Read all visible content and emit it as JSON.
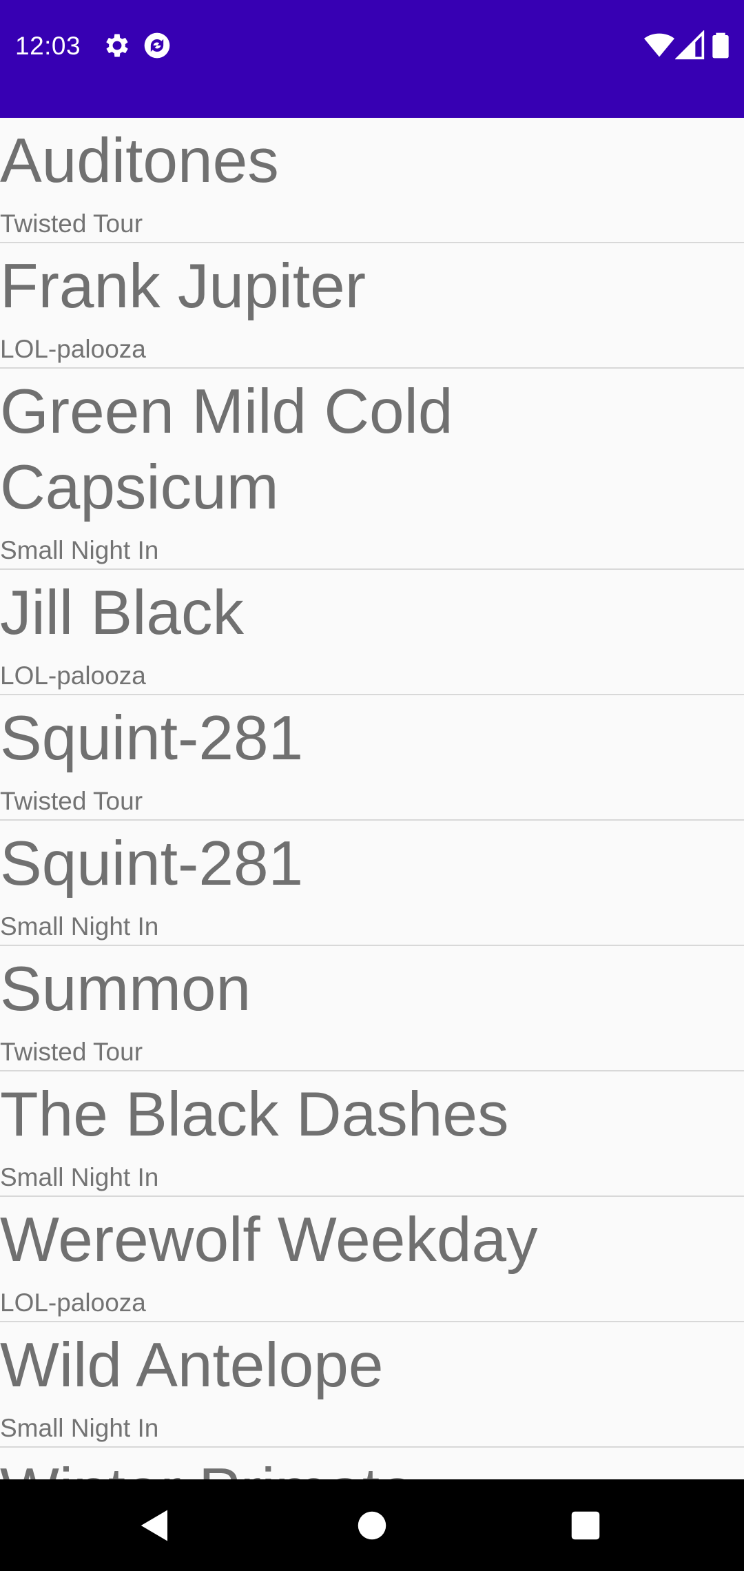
{
  "status_bar": {
    "time": "12:03",
    "left_icons": [
      "gear-icon",
      "sync-icon"
    ],
    "right_icons": [
      "wifi-icon",
      "signal-icon",
      "battery-icon"
    ],
    "background_color": "#3700b3"
  },
  "list": {
    "items": [
      {
        "title": "Auditones",
        "subtitle": "Twisted Tour"
      },
      {
        "title": "Frank Jupiter",
        "subtitle": "LOL-palooza"
      },
      {
        "title": "Green Mild Cold Capsicum",
        "subtitle": "Small Night In"
      },
      {
        "title": "Jill Black",
        "subtitle": "LOL-palooza"
      },
      {
        "title": "Squint-281",
        "subtitle": "Twisted Tour"
      },
      {
        "title": "Squint-281",
        "subtitle": "Small Night In"
      },
      {
        "title": "Summon",
        "subtitle": "Twisted Tour"
      },
      {
        "title": "The Black Dashes",
        "subtitle": "Small Night In"
      },
      {
        "title": "Werewolf Weekday",
        "subtitle": "LOL-palooza"
      },
      {
        "title": "Wild Antelope",
        "subtitle": "Small Night In"
      },
      {
        "title": "Winter Primate",
        "subtitle": ""
      }
    ]
  },
  "nav_bar": {
    "buttons": [
      "back-icon",
      "home-icon",
      "recents-icon"
    ]
  }
}
